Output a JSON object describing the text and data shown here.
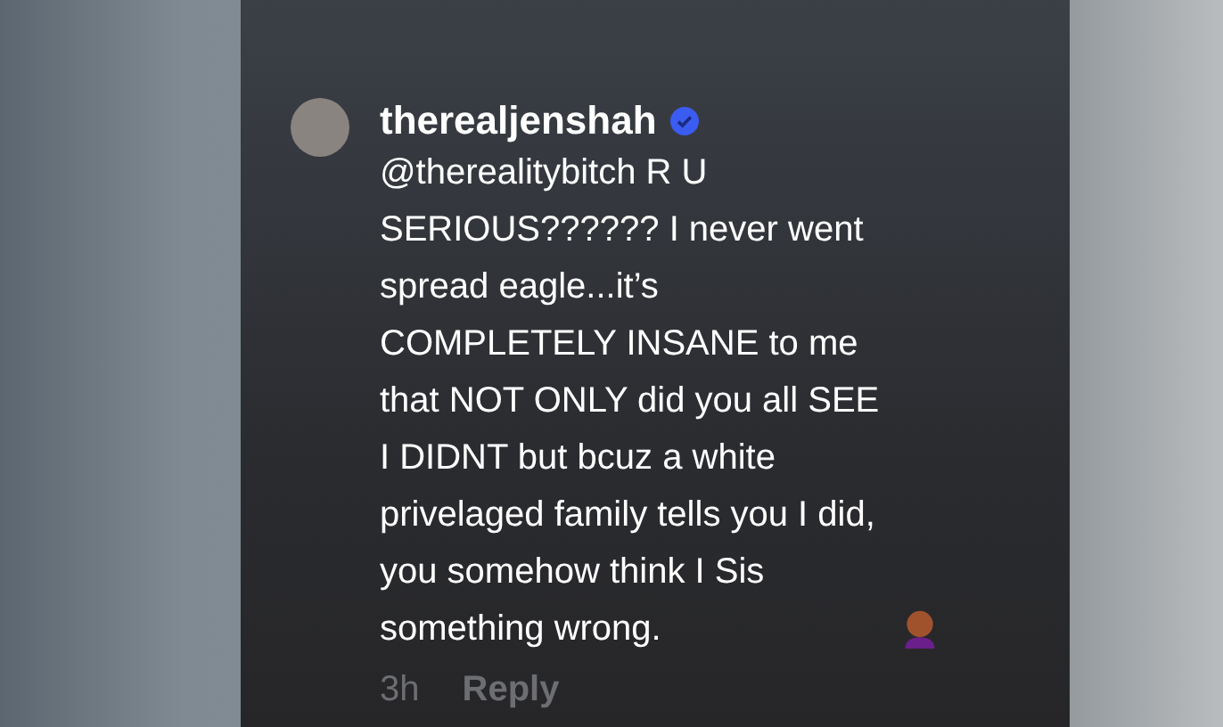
{
  "comment": {
    "username": "therealjenshah",
    "verified": true,
    "text": "@therealitybitch R U SERIOUS?????? I never went spread eagle...it’s COMPLETELY INSANE to me that NOT ONLY did you all SEE I DIDNT but bcuz a white privelaged family tells you I did, you somehow think I Sis something wrong.",
    "time": "3h",
    "reply": "Reply"
  }
}
